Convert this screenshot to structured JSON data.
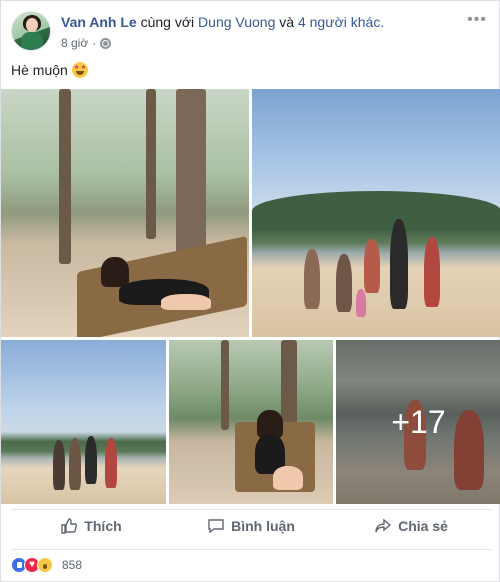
{
  "post": {
    "author": "Van Anh Le",
    "with_text": "cùng với",
    "tagged": "Dung Vuong",
    "and_text": "và",
    "others": "4 người khác.",
    "time": "8 giờ",
    "privacy_icon": "globe-icon",
    "more_icon": "ellipsis-icon",
    "caption": "Hè muộn",
    "caption_emoji": "star-struck-emoji"
  },
  "photos": {
    "extra_count": "+17"
  },
  "actions": {
    "like": "Thích",
    "comment": "Bình luận",
    "share": "Chia sẻ"
  },
  "reactions": {
    "types": [
      "like-icon",
      "love-icon",
      "wow-icon"
    ],
    "count": "858"
  },
  "colors": {
    "link": "#385898",
    "meta": "#616770",
    "action_text": "#606770",
    "like_blue": "#3b6ee8",
    "love_red": "#f0284a"
  }
}
